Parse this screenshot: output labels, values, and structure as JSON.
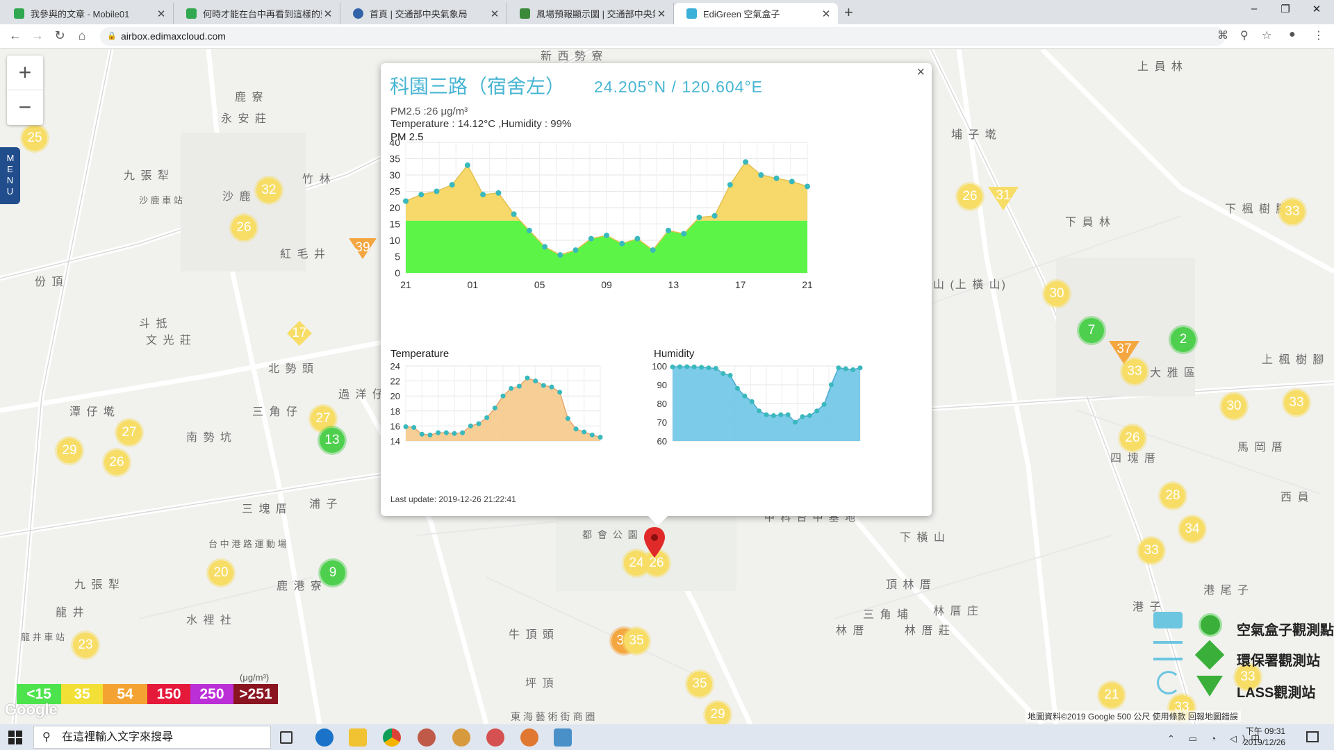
{
  "browser": {
    "tabs": [
      {
        "title": "我參與的文章 - Mobile01",
        "fav": "#2fa84f",
        "active": false
      },
      {
        "title": "何時才能在台中再看到這樣的藍天",
        "fav": "#2fa84f",
        "active": false
      },
      {
        "title": "首頁 | 交通部中央氣象局",
        "fav": "#3163a8",
        "active": false
      },
      {
        "title": "風場預報顯示圖 | 交通部中央氣象局",
        "fav": "#3a8a3a",
        "active": false
      },
      {
        "title": "EdiGreen 空氣盒子",
        "fav": "#3bb1d9",
        "active": true
      }
    ],
    "url": "airbox.edimaxcloud.com"
  },
  "map": {
    "zoom_in": "+",
    "zoom_out": "−",
    "menu_label": "MENU",
    "places": [
      "新 西 勢 寮",
      "鹿 寮",
      "永 安 莊",
      "九 張 犁",
      "沙 鹿",
      "竹 林",
      "紅 毛 井",
      "份 頂",
      "斗 抵",
      "文 光 莊",
      "北 勢 頭",
      "過 洋 仔",
      "三 角 仔",
      "潭 仔 墘",
      "南 勢 坑",
      "三 塊 厝",
      "浦 子",
      "九 張 犁",
      "龍 井",
      "水 裡 社",
      "鹿 港 寮",
      "牛 頂 頭",
      "坪 頂",
      "上 員 林",
      "埔 子 墘",
      "下 員 林",
      "下 楓 樹 腳",
      "山 (上 橫 山)",
      "大 雅 區",
      "上 楓 樹 腳",
      "四 塊 厝",
      "馬 岡 厝",
      "西 員",
      "下 橫 山",
      "頂 林 厝",
      "三 角 埔",
      "林 厝 庄",
      "林 厝",
      "林 厝 莊",
      "港 尾 子",
      "港 子",
      "都 會 公 園",
      "台 中 港 路 運 動 場",
      "東 海 藝 術 街 商 圈",
      "沙 鹿 車 站",
      "龍 井 車 站",
      "中 科 台 中 基 地"
    ],
    "markers": [
      "25",
      "32",
      "26",
      "39",
      "17",
      "27",
      "13",
      "29",
      "27",
      "26",
      "20",
      "9",
      "23",
      "24",
      "26",
      "35",
      "35",
      "29",
      "26",
      "31",
      "33",
      "30",
      "7",
      "37",
      "33",
      "2",
      "30",
      "33",
      "26",
      "28",
      "34",
      "33",
      "33",
      "21",
      "33"
    ],
    "legend": {
      "labels": [
        "<15",
        "35",
        "54",
        "150",
        "250",
        ">251"
      ],
      "unit": "(μg/m³)",
      "colors": [
        "#4de34d",
        "#f2e037",
        "#f4a332",
        "#e5193a",
        "#bb2fd6",
        "#8a1520"
      ]
    },
    "map_legend": [
      "空氣盒子觀測點",
      "環保署觀測站",
      "LASS觀測站"
    ],
    "attribution": "地圖資料©2019 Google   500 公尺          使用條款   回報地圖錯誤",
    "google": "Google"
  },
  "popup": {
    "close": "×",
    "title": "科園三路（宿舍左）",
    "coords": "24.205°N / 120.604°E",
    "pm_line": "PM2.5 :26 μg/m³",
    "env_line": "Temperature : 14.12°C ,Humidity : 99%",
    "chart1_title": "PM 2.5",
    "chart2_title": "Temperature",
    "chart3_title": "Humidity",
    "last_update": "Last update: 2019-12-26 21:22:41"
  },
  "chart_data": [
    {
      "type": "area",
      "title": "PM 2.5",
      "ylim": [
        0,
        40
      ],
      "yticks": [
        0,
        5,
        10,
        15,
        20,
        25,
        30,
        35,
        40
      ],
      "xticks": [
        "21",
        "01",
        "05",
        "09",
        "13",
        "17",
        "21"
      ],
      "values": [
        22,
        24,
        25,
        27,
        33,
        24,
        24.5,
        18,
        13,
        8,
        5.5,
        7,
        10.5,
        11.5,
        9,
        10.5,
        7,
        13,
        12,
        17,
        17.5,
        27,
        34,
        30,
        29,
        28,
        26.5
      ],
      "threshold": 16,
      "colors": {
        "above": "#f6d96a",
        "below": "#5cf547",
        "point": "#39b9bd"
      }
    },
    {
      "type": "area",
      "title": "Temperature",
      "ylim": [
        14,
        24
      ],
      "yticks": [
        14,
        16,
        18,
        20,
        22,
        24
      ],
      "values": [
        15.9,
        15.8,
        14.9,
        14.8,
        15.1,
        15.1,
        15.0,
        15.1,
        16.0,
        16.3,
        17.1,
        18.4,
        20.0,
        21.0,
        21.3,
        22.4,
        22.0,
        21.4,
        21.2,
        20.5,
        17.0,
        15.6,
        15.2,
        14.8,
        14.5
      ],
      "colors": {
        "fill": "#f6c98a",
        "point": "#39b9bd"
      }
    },
    {
      "type": "area",
      "title": "Humidity",
      "ylim": [
        60,
        100
      ],
      "yticks": [
        60,
        70,
        80,
        90,
        100
      ],
      "values": [
        99.5,
        99.6,
        99.6,
        99.5,
        99.3,
        99,
        98.7,
        96,
        95,
        88,
        84,
        81,
        76,
        74,
        73.5,
        74,
        74,
        70,
        73,
        73.5,
        76,
        79.5,
        90,
        99,
        98.5,
        98,
        99
      ],
      "colors": {
        "fill": "#6ec5e5",
        "point": "#39b9bd"
      }
    }
  ],
  "taskbar": {
    "search_placeholder": "在這裡輸入文字來搜尋",
    "time": "下午 09:31",
    "date": "2019/12/26",
    "ime": "中"
  }
}
